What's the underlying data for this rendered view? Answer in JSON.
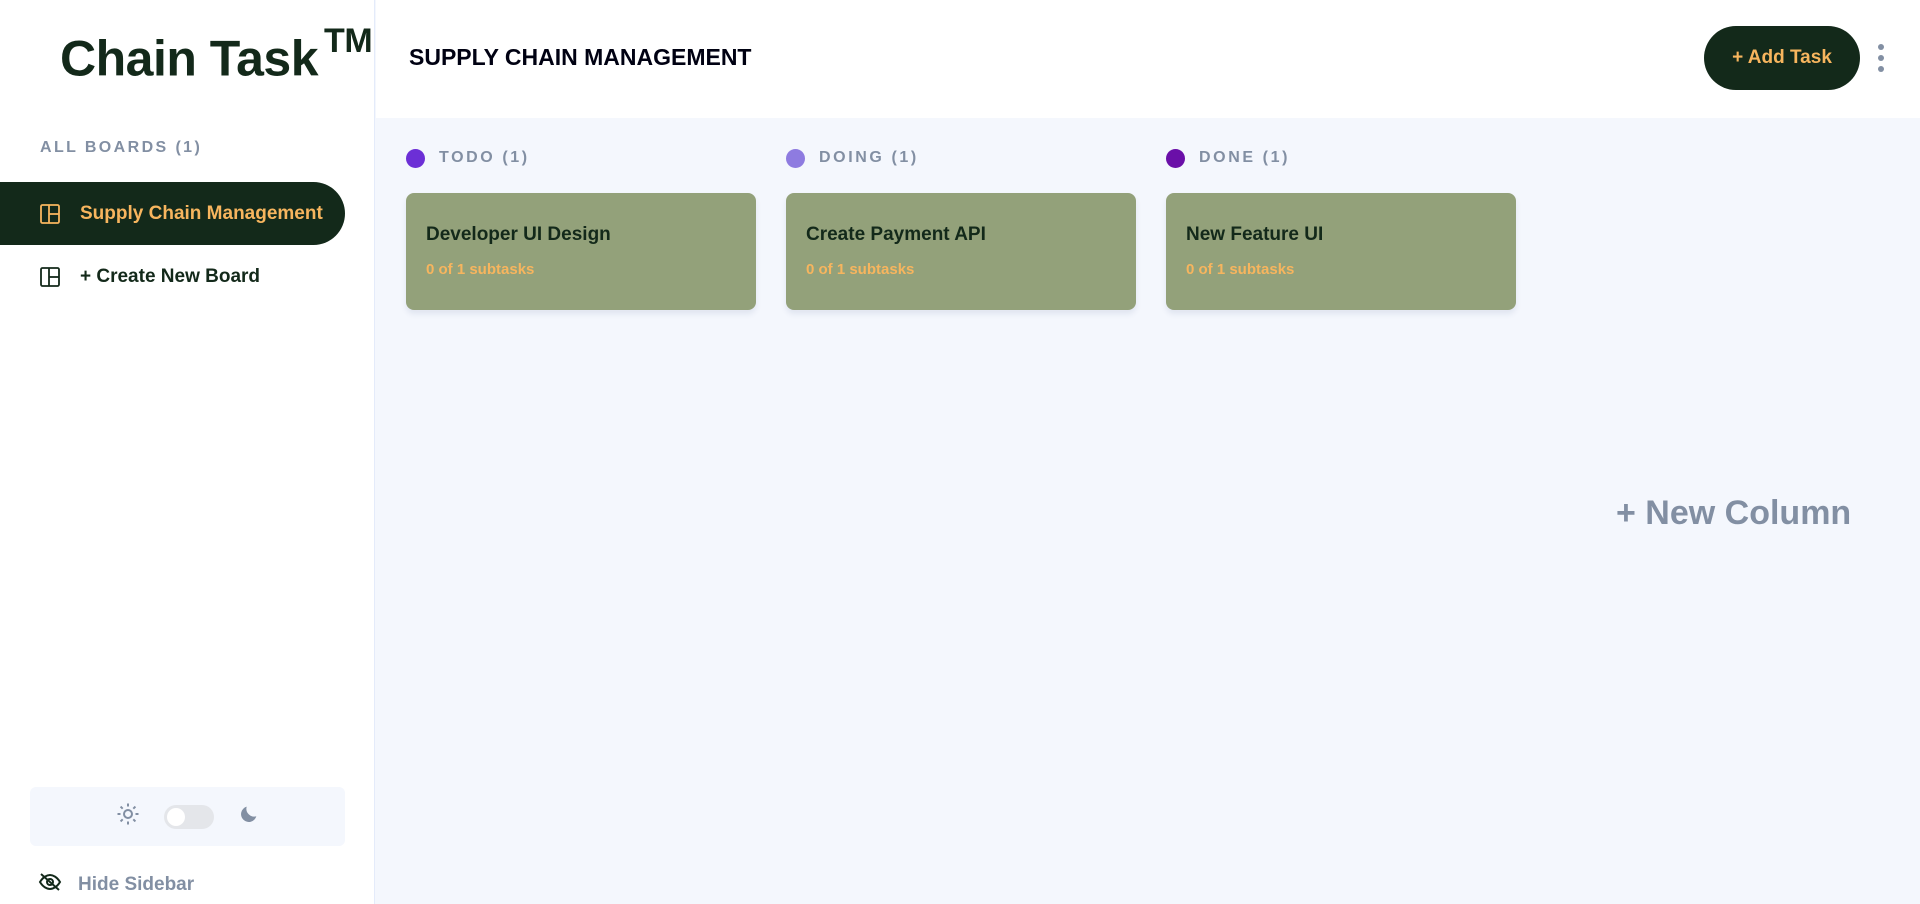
{
  "sidebar": {
    "logo_text": "Chain Task",
    "logo_mark": "TM",
    "boards_heading": "ALL BOARDS (1)",
    "boards": [
      {
        "label": "Supply Chain Management",
        "icon": "board-icon",
        "active": true
      }
    ],
    "create_board_label": "+ Create New Board",
    "theme": {
      "light_icon": "sun-icon",
      "dark_icon": "moon-icon",
      "mode": "light"
    },
    "hide_sidebar_label": "Hide Sidebar"
  },
  "header": {
    "board_title": "SUPPLY CHAIN MANAGEMENT",
    "add_task_label": "+ Add Task",
    "menu_icon": "vertical-ellipsis-icon"
  },
  "columns": [
    {
      "name": "TODO (1)",
      "color": "#6c2fd6",
      "tasks": [
        {
          "title": "Developer UI Design",
          "subtasks": "0 of 1 subtasks"
        }
      ]
    },
    {
      "name": "DOING (1)",
      "color": "#8e7be0",
      "tasks": [
        {
          "title": "Create Payment API",
          "subtasks": "0 of 1 subtasks"
        }
      ]
    },
    {
      "name": "DONE (1)",
      "color": "#6a0fa8",
      "tasks": [
        {
          "title": "New Feature UI",
          "subtasks": "0 of 1 subtasks"
        }
      ]
    }
  ],
  "new_column_label": "+ New Column",
  "colors": {
    "brand_dark": "#13291a",
    "accent": "#f7b55e",
    "card_bg": "#93a17a",
    "muted": "#828fa3",
    "board_bg": "#f4f7fd"
  }
}
